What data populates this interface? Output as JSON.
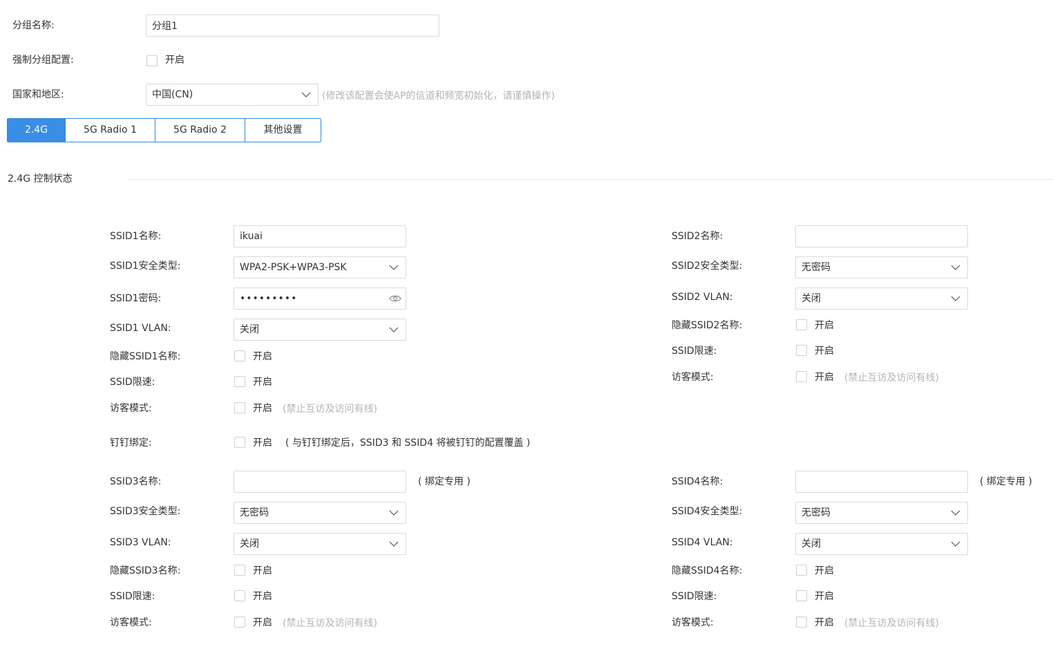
{
  "group": {
    "name_label": "分组名称:",
    "name_value": "分组1",
    "force_label": "强制分组配置:",
    "force_option": "开启",
    "country_label": "国家和地区:",
    "country_value": "中国(CN)",
    "country_hint": "(修改该配置会使AP的信道和频宽初始化，请谨慎操作)"
  },
  "tabs": [
    {
      "label": "2.4G",
      "active": true
    },
    {
      "label": "5G Radio 1",
      "active": false
    },
    {
      "label": "5G Radio 2",
      "active": false
    },
    {
      "label": "其他设置",
      "active": false
    }
  ],
  "section": {
    "title": "2.4G 控制状态"
  },
  "ssid1": {
    "name_label": "SSID1名称:",
    "name_value": "ikuai",
    "security_label": "SSID1安全类型:",
    "security_value": "WPA2-PSK+WPA3-PSK",
    "password_label": "SSID1密码:",
    "password_dots": "•••••••••",
    "vlan_label": "SSID1 VLAN:",
    "vlan_value": "关闭",
    "hide_label": "隐藏SSID1名称:",
    "hide_option": "开启",
    "limit_label": "SSID限速:",
    "limit_option": "开启",
    "guest_label": "访客模式:",
    "guest_option": "开启",
    "guest_hint": "(禁止互访及访问有线)"
  },
  "dingtalk": {
    "label": "钉钉绑定:",
    "option": "开启",
    "note": "( 与钉钉绑定后，SSID3 和 SSID4 将被钉钉的配置覆盖 )"
  },
  "ssid2": {
    "name_label": "SSID2名称:",
    "name_value": "",
    "security_label": "SSID2安全类型:",
    "security_value": "无密码",
    "vlan_label": "SSID2 VLAN:",
    "vlan_value": "关闭",
    "hide_label": "隐藏SSID2名称:",
    "hide_option": "开启",
    "limit_label": "SSID限速:",
    "limit_option": "开启",
    "guest_label": "访客模式:",
    "guest_option": "开启",
    "guest_hint": "(禁止互访及访问有线)"
  },
  "ssid3": {
    "name_label": "SSID3名称:",
    "name_value": "",
    "name_note": "( 绑定专用 )",
    "security_label": "SSID3安全类型:",
    "security_value": "无密码",
    "vlan_label": "SSID3 VLAN:",
    "vlan_value": "关闭",
    "hide_label": "隐藏SSID3名称:",
    "hide_option": "开启",
    "limit_label": "SSID限速:",
    "limit_option": "开启",
    "guest_label": "访客模式:",
    "guest_option": "开启",
    "guest_hint": "(禁止互访及访问有线)"
  },
  "ssid4": {
    "name_label": "SSID4名称:",
    "name_value": "",
    "name_note": "( 绑定专用 )",
    "security_label": "SSID4安全类型:",
    "security_value": "无密码",
    "vlan_label": "SSID4 VLAN:",
    "vlan_value": "关闭",
    "hide_label": "隐藏SSID4名称:",
    "hide_option": "开启",
    "limit_label": "SSID限速:",
    "limit_option": "开启",
    "guest_label": "访客模式:",
    "guest_option": "开启",
    "guest_hint": "(禁止互访及访问有线)"
  }
}
